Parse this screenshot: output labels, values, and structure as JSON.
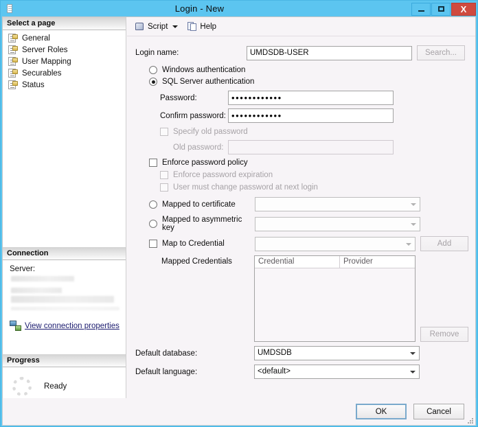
{
  "window": {
    "title": "Login - New",
    "icon": "login-document-icon",
    "minimize_label": "Minimize",
    "maximize_label": "Maximize",
    "close_label": "X"
  },
  "toolbar": {
    "script_label": "Script",
    "script_icon": "script-icon",
    "dropdown_icon": "chevron-down-icon",
    "help_label": "Help",
    "help_icon": "help-document-icon"
  },
  "sidebar": {
    "select_page_header": "Select a page",
    "pages": [
      {
        "label": "General",
        "icon": "page-icon"
      },
      {
        "label": "Server Roles",
        "icon": "page-icon"
      },
      {
        "label": "User Mapping",
        "icon": "page-icon"
      },
      {
        "label": "Securables",
        "icon": "page-icon"
      },
      {
        "label": "Status",
        "icon": "page-icon"
      }
    ],
    "connection_header": "Connection",
    "server_label": "Server:",
    "server_value": "",
    "view_connection_properties": "View connection properties",
    "connection_icon": "server-connection-icon",
    "progress_header": "Progress",
    "progress_status": "Ready",
    "progress_icon": "spinner-icon"
  },
  "form": {
    "login_name_label": "Login name:",
    "login_name_value": "UMDSDB-USER",
    "search_button": "Search...",
    "windows_auth_label": "Windows authentication",
    "sql_auth_label": "SQL Server authentication",
    "password_label": "Password:",
    "password_value": "••••••••••••",
    "confirm_password_label": "Confirm password:",
    "confirm_password_value": "••••••••••••",
    "specify_old_password_label": "Specify old password",
    "old_password_label": "Old password:",
    "old_password_value": "",
    "enforce_password_policy_label": "Enforce password policy",
    "enforce_password_expiration_label": "Enforce password expiration",
    "user_must_change_label": "User must change password at next login",
    "mapped_to_certificate_label": "Mapped to certificate",
    "mapped_to_certificate_value": "",
    "mapped_to_asymmetric_key_label": "Mapped to asymmetric key",
    "mapped_to_asymmetric_key_value": "",
    "map_to_credential_label": "Map to Credential",
    "map_to_credential_value": "",
    "add_button": "Add",
    "mapped_credentials_label": "Mapped Credentials",
    "grid_columns": [
      "Credential",
      "Provider"
    ],
    "grid_rows": [],
    "remove_button": "Remove",
    "default_database_label": "Default database:",
    "default_database_value": "UMDSDB",
    "default_language_label": "Default language:",
    "default_language_value": "<default>"
  },
  "footer": {
    "ok_label": "OK",
    "cancel_label": "Cancel"
  },
  "colors": {
    "titlebar": "#5cc5f0",
    "close_button": "#cf4a3f",
    "panel_background": "#f7f4f7",
    "link": "#1a1a6e",
    "default_button_border": "#7aa9cc"
  }
}
